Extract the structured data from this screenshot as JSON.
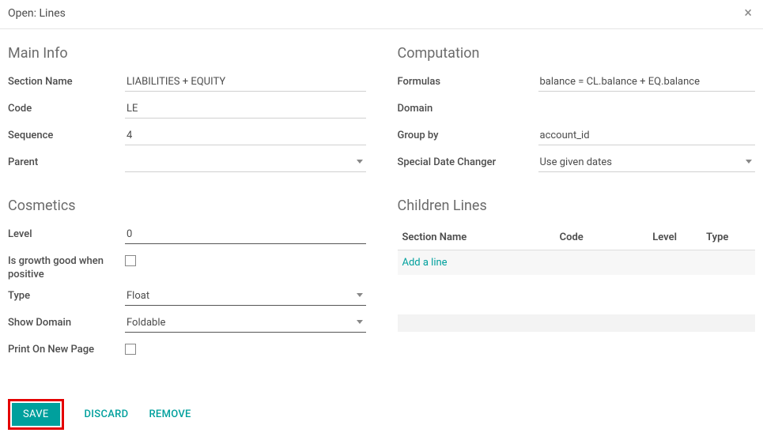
{
  "header": {
    "title": "Open: Lines"
  },
  "mainInfo": {
    "heading": "Main Info",
    "labels": {
      "sectionName": "Section Name",
      "code": "Code",
      "sequence": "Sequence",
      "parent": "Parent"
    },
    "values": {
      "sectionName": "LIABILITIES + EQUITY",
      "code": "LE",
      "sequence": "4",
      "parent": ""
    }
  },
  "cosmetics": {
    "heading": "Cosmetics",
    "labels": {
      "level": "Level",
      "growth": "Is growth good when positive",
      "type": "Type",
      "showDomain": "Show Domain",
      "printNew": "Print On New Page"
    },
    "values": {
      "level": "0",
      "type": "Float",
      "showDomain": "Foldable"
    }
  },
  "computation": {
    "heading": "Computation",
    "labels": {
      "formulas": "Formulas",
      "domain": "Domain",
      "groupBy": "Group by",
      "specialDate": "Special Date Changer"
    },
    "values": {
      "formulas": "balance = CL.balance + EQ.balance",
      "domain": "",
      "groupBy": "account_id",
      "specialDate": "Use given dates"
    }
  },
  "children": {
    "heading": "Children Lines",
    "columns": {
      "sectionName": "Section Name",
      "code": "Code",
      "level": "Level",
      "type": "Type"
    },
    "addLine": "Add a line"
  },
  "footer": {
    "save": "SAVE",
    "discard": "DISCARD",
    "remove": "REMOVE"
  }
}
